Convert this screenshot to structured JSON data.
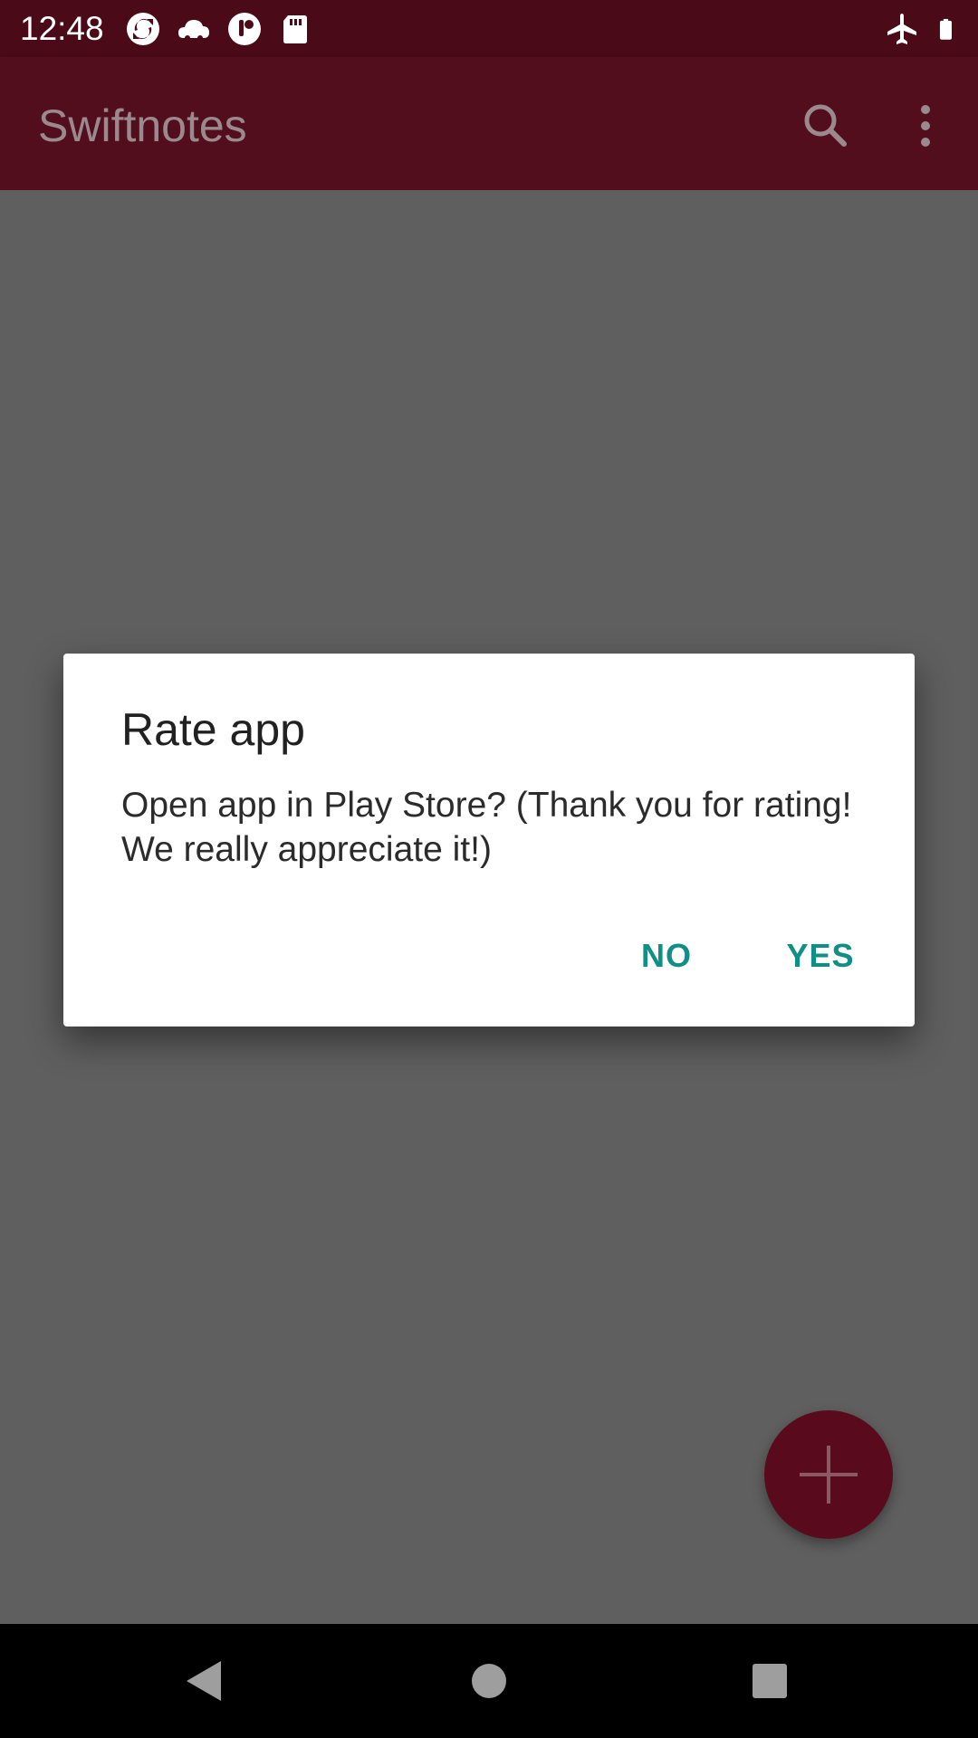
{
  "status_bar": {
    "time": "12:48",
    "left_icons": [
      "sync-icon",
      "cloud-icon",
      "notification-app-icon",
      "sd-card-icon"
    ],
    "right_icons": [
      "airplane-mode-icon",
      "battery-icon"
    ]
  },
  "app_bar": {
    "title": "Swiftnotes",
    "actions": [
      "search-icon",
      "more-vert-icon"
    ]
  },
  "dialog": {
    "title": "Rate app",
    "message": "Open app in Play Store? (Thank you for rating! We really appreciate it!)",
    "negative_label": "NO",
    "positive_label": "YES"
  },
  "fab": {
    "icon": "plus-icon"
  },
  "nav_bar": {
    "buttons": [
      "back-icon",
      "home-icon",
      "recents-icon"
    ]
  },
  "colors": {
    "status_bar": "#4a0a18",
    "app_bar": "#530e1e",
    "accent": "#0f8f86",
    "fab": "#5a0a1d",
    "scrim": "#5f5f5f"
  }
}
